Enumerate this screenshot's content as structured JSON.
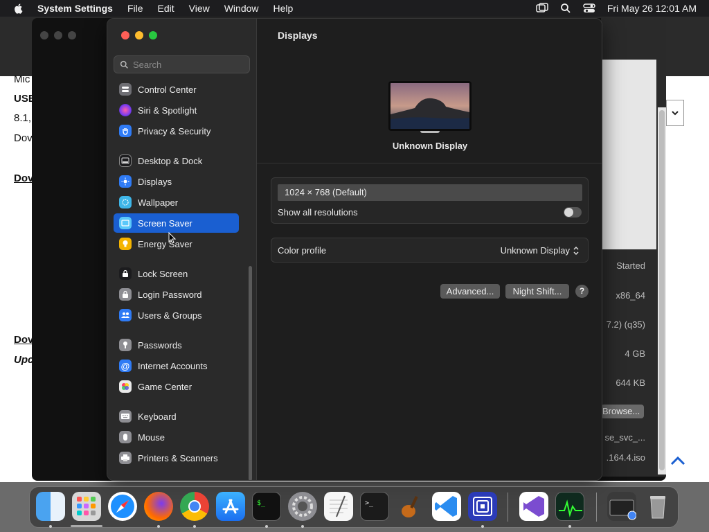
{
  "menubar": {
    "app_name": "System Settings",
    "menus": [
      "File",
      "Edit",
      "View",
      "Window",
      "Help"
    ],
    "datetime": "Fri May 26  12:01 AM"
  },
  "background": {
    "browser_text": [
      "Mic",
      "USB",
      "8.1,",
      "Dov",
      "Dov",
      "Dov",
      "Upc"
    ],
    "right_values": [
      "Started",
      "x86_64",
      "7.2) (q35)",
      "4 GB",
      "644 KB",
      "se_svc_...",
      ".164.4.iso"
    ],
    "browse_label": "Browse..."
  },
  "sidebar": {
    "search_placeholder": "Search",
    "items": [
      {
        "label": "Control Center",
        "color": "#6e6e73"
      },
      {
        "label": "Siri & Spotlight",
        "color": "#b44dc8"
      },
      {
        "label": "Privacy & Security",
        "color": "#2f7bf5"
      },
      {
        "label": "Desktop & Dock",
        "color": "#1c1c1e"
      },
      {
        "label": "Displays",
        "color": "#2f7bf5"
      },
      {
        "label": "Wallpaper",
        "color": "#3fb6e8"
      },
      {
        "label": "Screen Saver",
        "color": "#5ac8fa"
      },
      {
        "label": "Energy Saver",
        "color": "#f5b400"
      },
      {
        "label": "Lock Screen",
        "color": "#1c1c1e"
      },
      {
        "label": "Login Password",
        "color": "#8e8e93"
      },
      {
        "label": "Users & Groups",
        "color": "#2f7bf5"
      },
      {
        "label": "Passwords",
        "color": "#8e8e93"
      },
      {
        "label": "Internet Accounts",
        "color": "#2f7bf5"
      },
      {
        "label": "Game Center",
        "color": "#e9e9e9"
      },
      {
        "label": "Keyboard",
        "color": "#8e8e93"
      },
      {
        "label": "Mouse",
        "color": "#8e8e93"
      },
      {
        "label": "Printers & Scanners",
        "color": "#8e8e93"
      }
    ]
  },
  "content": {
    "title": "Displays",
    "display_name": "Unknown Display",
    "resolution": "1024 × 768 (Default)",
    "show_all_label": "Show all resolutions",
    "color_profile_label": "Color profile",
    "color_profile_value": "Unknown Display",
    "advanced_button": "Advanced...",
    "night_shift_button": "Night Shift...",
    "help_button": "?"
  },
  "dock": {
    "apps": [
      "Finder",
      "Launchpad",
      "Safari",
      "Firefox",
      "Chrome",
      "App Store",
      "Terminal",
      "System Settings",
      "TextEdit",
      "Terminal",
      "GarageBand",
      "Visual Studio Code",
      "Simulator",
      "Visual Studio",
      "Activity Monitor",
      "Downloads",
      "Trash"
    ]
  },
  "colors": {
    "accent": "#1a5fd1",
    "window_bg": "#1e1e1e",
    "sidebar_bg": "#2a2a2a"
  }
}
